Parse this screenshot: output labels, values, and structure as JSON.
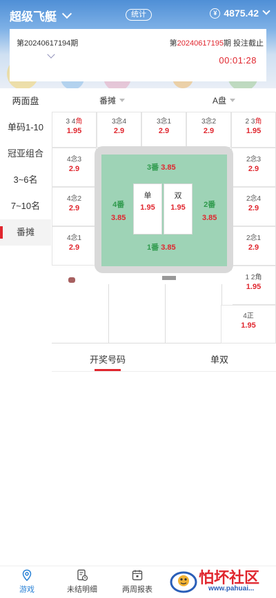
{
  "header": {
    "app_title": "超级飞艇",
    "stats_label": "统计",
    "balance_symbol": "¥",
    "balance": "4875.42"
  },
  "period": {
    "prev_prefix": "第",
    "prev_number": "20240617194",
    "prev_suffix": "期",
    "cur_prefix": "第",
    "cur_number": "20240617195",
    "cur_suffix": "期 投注截止",
    "countdown": "00:01:28"
  },
  "leftnav": [
    {
      "label": "两面盘"
    },
    {
      "label": "单码1-10"
    },
    {
      "label": "冠亚组合"
    },
    {
      "label": "3~6名"
    },
    {
      "label": "7~10名"
    },
    {
      "label": "番摊"
    }
  ],
  "selectors": {
    "game": "番摊",
    "plate": "A盘"
  },
  "board": {
    "top_row": [
      {
        "num": "3 4",
        "kind": "角",
        "odds": "1.95"
      },
      {
        "num": "3",
        "kind": "念4",
        "odds": "2.9"
      },
      {
        "num": "3",
        "kind": "念1",
        "odds": "2.9"
      },
      {
        "num": "3",
        "kind": "念2",
        "odds": "2.9"
      },
      {
        "num": "2 3",
        "kind": "角",
        "odds": "1.95"
      }
    ],
    "left_col": [
      {
        "label": "4念3",
        "odds": "2.9"
      },
      {
        "label": "4念2",
        "odds": "2.9"
      },
      {
        "label": "4念1",
        "odds": "2.9"
      }
    ],
    "right_col": [
      {
        "label": "2念3",
        "odds": "2.9"
      },
      {
        "label": "2念4",
        "odds": "2.9"
      },
      {
        "label": "2念1",
        "odds": "2.9"
      },
      {
        "label": "1 2角",
        "odds": "1.95"
      },
      {
        "label": "4正",
        "odds": "1.95"
      }
    ],
    "fan3": {
      "label": "3番",
      "odds": "3.85"
    },
    "fan4": {
      "label": "4番",
      "odds": "3.85"
    },
    "fan2": {
      "label": "2番",
      "odds": "3.85"
    },
    "fan1": {
      "label": "1番",
      "odds": "3.85"
    },
    "single": {
      "label": "单",
      "odds": "1.95"
    },
    "double": {
      "label": "双",
      "odds": "1.95"
    }
  },
  "tabs": [
    {
      "label": "开奖号码"
    },
    {
      "label": "单双"
    }
  ],
  "footer": [
    {
      "label": "游戏",
      "icon": "location-pin-icon"
    },
    {
      "label": "未结明细",
      "icon": "document-clock-icon"
    },
    {
      "label": "两周报表",
      "icon": "calendar-icon"
    }
  ],
  "watermark": {
    "text": "怕坏社区",
    "url": "www.pahuai..."
  },
  "colors": {
    "accent_red": "#e0262e",
    "green_area": "#9ed3b6",
    "green_text": "#2f9a4d",
    "footer_active": "#2a82d6"
  }
}
